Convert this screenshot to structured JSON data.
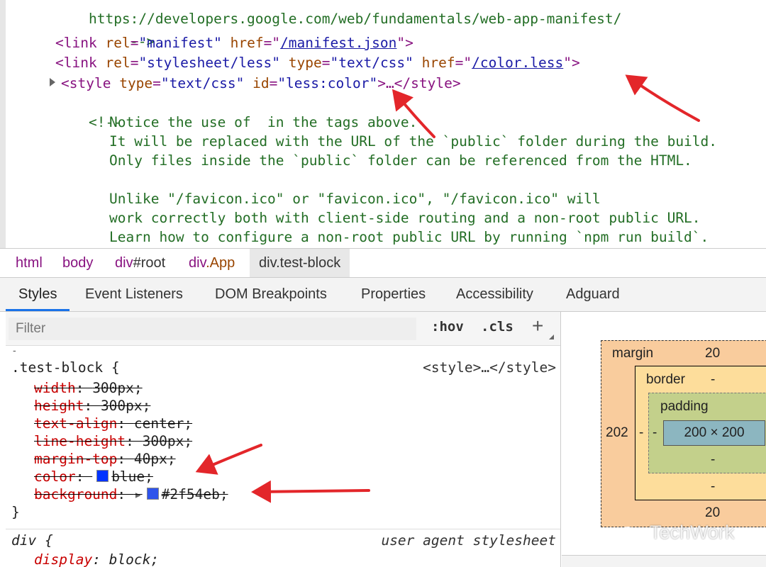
{
  "source": {
    "line1": "https://developers.google.com/web/fundamentals/web-app-manifest/",
    "line2": "-->",
    "link_manifest": {
      "open": "<link",
      "rel_attr": "rel",
      "rel_value": "\"manifest\"",
      "href_attr": "href",
      "href_value": "/manifest.json",
      "close": ">"
    },
    "link_less": {
      "open": "<link",
      "rel_attr": "rel",
      "rel_value": "\"stylesheet/less\"",
      "type_attr": "type",
      "type_value": "\"text/css\"",
      "href_attr": "href",
      "href_value": "/color.less",
      "close": ">"
    },
    "style_tag": {
      "open": "<style",
      "type_attr": "type",
      "type_value": "\"text/css\"",
      "id_attr": "id",
      "id_value": "\"less:color\"",
      "rest": ">…</style>"
    },
    "comment_open": "<!--",
    "comment_lines": [
      "Notice the use of  in the tags above.",
      "It will be replaced with the URL of the `public` folder during the build.",
      "Only files inside the `public` folder can be referenced from the HTML.",
      "",
      "Unlike \"/favicon.ico\" or \"favicon.ico\", \"/favicon.ico\" will",
      "work correctly both with client-side routing and a non-root public URL.",
      "Learn how to configure a non-root public URL by running `npm run build`."
    ]
  },
  "breadcrumb": [
    {
      "tag": "html",
      "rest": ""
    },
    {
      "tag": "body",
      "rest": ""
    },
    {
      "tag": "div",
      "rest": "#root"
    },
    {
      "tag": "div",
      "rest": ".App"
    },
    {
      "tag": "div",
      "rest": ".test-block"
    }
  ],
  "tabs": [
    "Styles",
    "Event Listeners",
    "DOM Breakpoints",
    "Properties",
    "Accessibility",
    "Adguard"
  ],
  "active_tab": "Styles",
  "filter": {
    "placeholder": "Filter",
    "hov": ":hov",
    "cls": ".cls",
    "add": "+",
    "dash": "-"
  },
  "rules": [
    {
      "selector": ".test-block {",
      "source": "<style>…</style>",
      "props": [
        {
          "name": "width",
          "value": "300px;"
        },
        {
          "name": "height",
          "value": "300px;"
        },
        {
          "name": "text-align",
          "value": "center;"
        },
        {
          "name": "line-height",
          "value": "300px;"
        },
        {
          "name": "margin-top",
          "value": "40px;"
        },
        {
          "name": "color",
          "value": "blue;",
          "swatch": "#0033ff"
        },
        {
          "name": "background",
          "value": "#2f54eb;",
          "swatch": "#2f54eb",
          "expand": "▸"
        }
      ],
      "close": "}"
    },
    {
      "selector": "div {",
      "source": "user agent stylesheet",
      "props": [
        {
          "name": "display",
          "value": "block;"
        }
      ]
    }
  ],
  "box_model": {
    "margin_label": "margin",
    "margin_top": "20",
    "margin_bottom": "20",
    "margin_left": "202",
    "border_label": "border",
    "border_top": "-",
    "border_bottom": "-",
    "border_left": "-",
    "padding_label": "padding",
    "padding_bottom": "-",
    "padding_left": "-",
    "content": "200 × 200"
  },
  "watermark": "TechWork",
  "colors": {
    "tag": "#881280",
    "attr": "#994500",
    "value": "#1a1aa6",
    "comment": "#236e25",
    "annotation_arrow": "#e3262a",
    "active_tab": "#1a73e8"
  }
}
